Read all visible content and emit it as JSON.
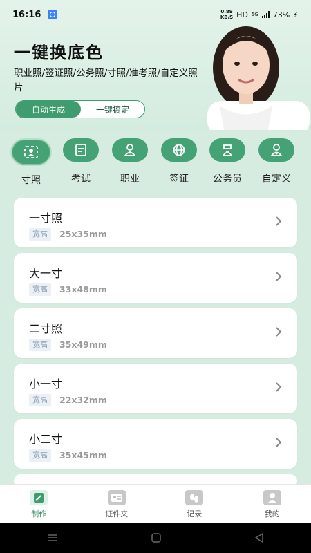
{
  "status": {
    "time": "16:16",
    "net_speed_value": "0.89",
    "net_speed_unit": "KB/S",
    "hd": "HD",
    "network": "5G",
    "battery": "73%"
  },
  "hero": {
    "title": "一键换底色",
    "description": "职业照/签证照/公务照/寸照/准考照/自定义照片",
    "btn_auto": "自动生成",
    "btn_one_click": "一键搞定"
  },
  "categories": [
    {
      "label": "寸照",
      "icon": "id-photo-icon",
      "active": true
    },
    {
      "label": "考试",
      "icon": "exam-icon",
      "active": false
    },
    {
      "label": "职业",
      "icon": "professional-icon",
      "active": false
    },
    {
      "label": "签证",
      "icon": "globe-icon",
      "active": false
    },
    {
      "label": "公务员",
      "icon": "civil-servant-icon",
      "active": false
    },
    {
      "label": "自定义",
      "icon": "custom-user-icon",
      "active": false
    }
  ],
  "cards": [
    {
      "title": "一寸照",
      "tag": "宽高",
      "size": "25x35mm"
    },
    {
      "title": "大一寸",
      "tag": "宽高",
      "size": "33x48mm"
    },
    {
      "title": "二寸照",
      "tag": "宽高",
      "size": "35x49mm"
    },
    {
      "title": "小一寸",
      "tag": "宽高",
      "size": "22x32mm"
    },
    {
      "title": "小二寸",
      "tag": "宽高",
      "size": "35x45mm"
    }
  ],
  "bottom_nav": [
    {
      "label": "制作",
      "icon": "edit-icon",
      "active": true
    },
    {
      "label": "证件夹",
      "icon": "id-card-icon",
      "active": false
    },
    {
      "label": "记录",
      "icon": "footprint-icon",
      "active": false
    },
    {
      "label": "我的",
      "icon": "profile-icon",
      "active": false
    }
  ],
  "colors": {
    "accent": "#3e9c6e",
    "background": "#d7ece0"
  }
}
